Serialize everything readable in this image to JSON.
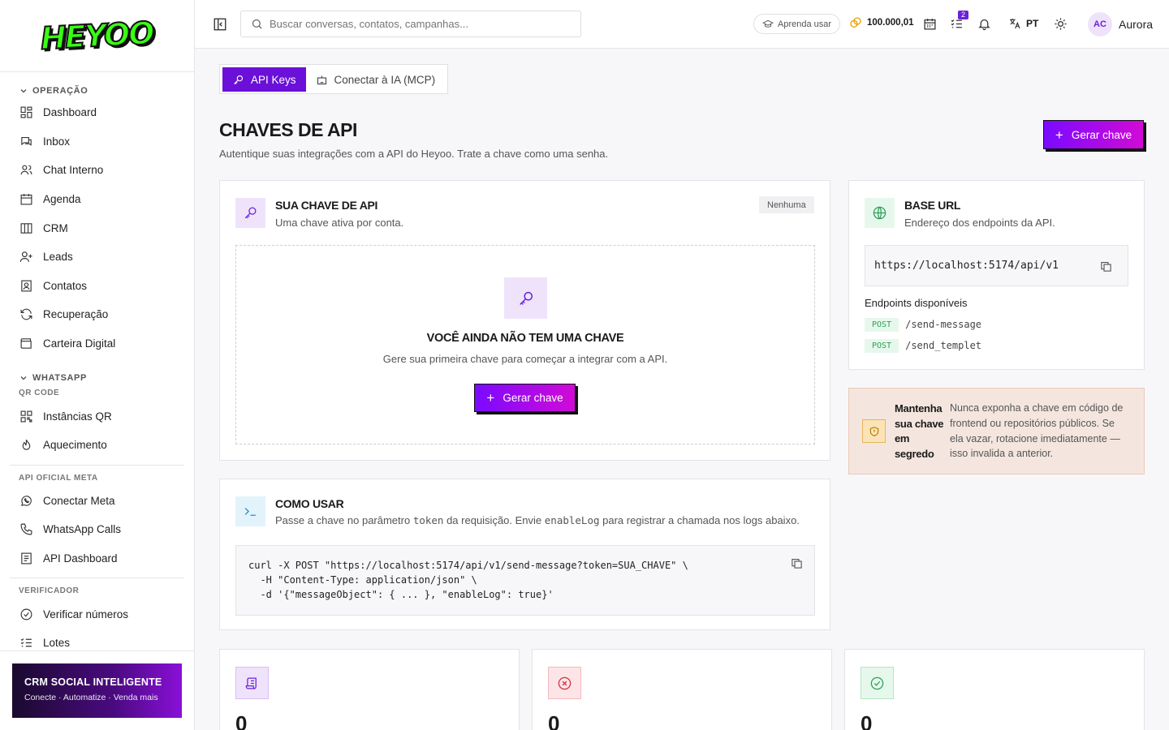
{
  "brand": {
    "logo": "HEYOO"
  },
  "sidebar": {
    "sections": [
      {
        "title": "OPERAÇÃO",
        "items": [
          {
            "label": "Dashboard",
            "icon": "dashboard-icon"
          },
          {
            "label": "Inbox",
            "icon": "inbox-icon"
          },
          {
            "label": "Chat Interno",
            "icon": "users-icon"
          },
          {
            "label": "Agenda",
            "icon": "calendar-icon"
          },
          {
            "label": "CRM",
            "icon": "kanban-icon"
          },
          {
            "label": "Leads",
            "icon": "user-plus-icon"
          },
          {
            "label": "Contatos",
            "icon": "contact-book-icon"
          },
          {
            "label": "Recuperação",
            "icon": "refresh-icon"
          },
          {
            "label": "Carteira Digital",
            "icon": "wallet-icon"
          }
        ]
      },
      {
        "title": "WHATSAPP",
        "subtitle": "QR CODE",
        "items": [
          {
            "label": "Instâncias QR",
            "icon": "qr-icon"
          },
          {
            "label": "Aquecimento",
            "icon": "flame-icon"
          }
        ]
      },
      {
        "subtitle": "API OFICIAL META",
        "items": [
          {
            "label": "Conectar Meta",
            "icon": "whatsapp-icon"
          },
          {
            "label": "WhatsApp Calls",
            "icon": "phone-icon"
          },
          {
            "label": "API Dashboard",
            "icon": "api-dashboard-icon"
          }
        ]
      },
      {
        "subtitle": "VERIFICADOR",
        "items": [
          {
            "label": "Verificar números",
            "icon": "check-circle-icon"
          },
          {
            "label": "Lotes",
            "icon": "list-check-icon"
          }
        ]
      }
    ],
    "promo": {
      "title": "CRM SOCIAL INTELIGENTE",
      "subtitle": "Conecte · Automatize · Venda mais"
    }
  },
  "header": {
    "search_placeholder": "Buscar conversas, contatos, campanhas...",
    "learn_label": "Aprenda usar",
    "credits": "100.000,01",
    "tasks_badge": "2",
    "lang": "PT",
    "avatar_initials": "AC",
    "username": "Aurora"
  },
  "tabs": [
    {
      "label": "API Keys",
      "active": true
    },
    {
      "label": "Conectar à IA (MCP)",
      "active": false
    }
  ],
  "page": {
    "title": "CHAVES DE API",
    "subtitle": "Autentique suas integrações com a API do Heyoo. Trate a chave como uma senha.",
    "generate_label": "Gerar chave"
  },
  "key_card": {
    "title": "SUA CHAVE DE API",
    "subtitle": "Uma chave ativa por conta.",
    "status": "Nenhuma",
    "empty_title": "VOCÊ AINDA NÃO TEM UMA CHAVE",
    "empty_subtitle": "Gere sua primeira chave para começar a integrar com a API.",
    "generate_label": "Gerar chave"
  },
  "usage_card": {
    "title": "COMO USAR",
    "subtitle_a": "Passe a chave no parâmetro ",
    "subtitle_code1": "token",
    "subtitle_b": " da requisição. Envie ",
    "subtitle_code2": "enableLog",
    "subtitle_c": " para registrar a chamada nos logs abaixo.",
    "code_lines": [
      "curl -X POST \"https://localhost:5174/api/v1/send-message?token=SUA_CHAVE\" \\",
      "  -H \"Content-Type: application/json\" \\",
      "  -d '{\"messageObject\": { ... }, \"enableLog\": true}'"
    ]
  },
  "base_url_card": {
    "title": "BASE URL",
    "subtitle": "Endereço dos endpoints da API.",
    "url": "https://localhost:5174/api/v1",
    "endpoints_label": "Endpoints disponíveis",
    "endpoints": [
      {
        "method": "POST",
        "path": "/send-message"
      },
      {
        "method": "POST",
        "path": "/send_templet"
      }
    ]
  },
  "warning": {
    "title": "Mantenha sua chave em segredo",
    "text": "Nunca exponha a chave em código de frontend ou repositórios públicos. Se ela vazar, rotacione imediatamente — isso invalida a anterior."
  },
  "stats": [
    {
      "value": "0",
      "icon": "scroll-icon",
      "color": "#6b21d8"
    },
    {
      "value": "0",
      "icon": "x-circle-icon",
      "color": "#d62c3c"
    },
    {
      "value": "0",
      "icon": "check-circle-icon",
      "color": "#2f9e5a"
    }
  ],
  "colors": {
    "accent": "#6b10d8",
    "accent_end": "#d10ad6",
    "logo_green": "#39ff14"
  }
}
